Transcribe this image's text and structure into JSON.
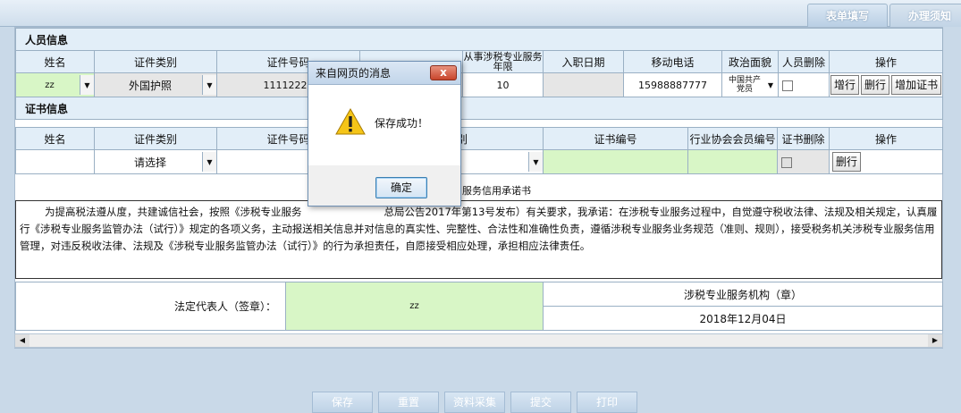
{
  "tabs": {
    "form_fill": "表单填写",
    "instructions": "办理须知"
  },
  "personnel": {
    "section_title": "人员信息",
    "headers": [
      "姓名",
      "证件类别",
      "证件号码",
      "",
      "从事涉税专业服务年限",
      "入职日期",
      "移动电话",
      "政治面貌",
      "人员删除",
      "操作"
    ],
    "row": {
      "name": "zz",
      "id_type": "外国护照",
      "id_number": "11112222",
      "years": "10",
      "entry_date": "",
      "mobile": "15988887777",
      "political": "中国共产党员"
    },
    "actions": [
      "增行",
      "删行",
      "增加证书"
    ]
  },
  "certificate": {
    "section_title": "证书信息",
    "headers": [
      "姓名",
      "证件类别",
      "证件号码",
      "书类别",
      "证书编号",
      "行业协会会员编号",
      "证书删除",
      "操作"
    ],
    "row": {
      "id_type": "请选择"
    },
    "actions": [
      "删行"
    ]
  },
  "pledge": {
    "title": "服务信用承诺书",
    "text": "为提高税法遵从度，共建诚信社会，按照《涉税专业服务　　　　　　　　总局公告2017年第13号发布）有关要求，我承诺：在涉税专业服务过程中，自觉遵守税收法律、法规及相关规定，认真履行《涉税专业服务监管办法（试行）》规定的各项义务，主动报送相关信息并对信息的真实性、完整性、合法性和准确性负责，遵循涉税专业服务业务规范（准则、规则），接受税务机关涉税专业服务信用管理，对违反税收法律、法规及《涉税专业服务监管办法（试行）》的行为承担责任，自愿接受相应处理，承担相应法律责任。"
  },
  "signature": {
    "legal_rep_label": "法定代表人（签章）：",
    "legal_rep_value": "zz",
    "org_label": "涉税专业服务机构（章）",
    "date": "2018年12月04日"
  },
  "bottom_buttons": [
    "保存",
    "重置",
    "资料采集",
    "提交",
    "打印"
  ],
  "dialog": {
    "title": "来自网页的消息",
    "message": "保存成功！",
    "ok_label": "确定",
    "close_label": "x"
  }
}
